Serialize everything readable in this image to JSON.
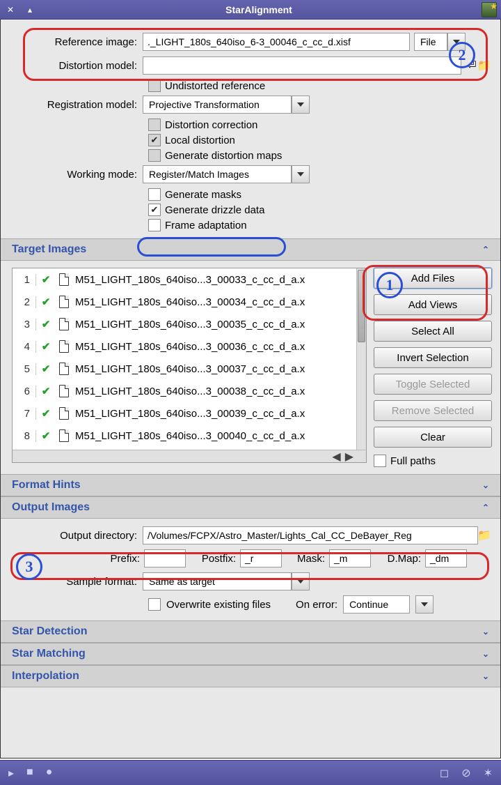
{
  "title": "StarAlignment",
  "form": {
    "reference_label": "Reference image:",
    "reference_value": "._LIGHT_180s_640iso_6-3_00046_c_cc_d.xisf",
    "reference_source": "File",
    "distortion_label": "Distortion model:",
    "distortion_value": "",
    "undistorted": "Undistorted reference",
    "reg_model_label": "Registration model:",
    "reg_model_value": "Projective Transformation",
    "distortion_corr": "Distortion correction",
    "local_distortion": "Local distortion",
    "gen_maps": "Generate distortion maps",
    "working_mode_label": "Working mode:",
    "working_mode_value": "Register/Match Images",
    "gen_masks": "Generate masks",
    "gen_drizzle": "Generate drizzle data",
    "frame_adapt": "Frame adaptation"
  },
  "sections": {
    "target": "Target Images",
    "format_hints": "Format Hints",
    "output_images": "Output Images",
    "star_detection": "Star Detection",
    "star_matching": "Star Matching",
    "interpolation": "Interpolation"
  },
  "files": [
    "M51_LIGHT_180s_640iso...3_00033_c_cc_d_a.x",
    "M51_LIGHT_180s_640iso...3_00034_c_cc_d_a.x",
    "M51_LIGHT_180s_640iso...3_00035_c_cc_d_a.x",
    "M51_LIGHT_180s_640iso...3_00036_c_cc_d_a.x",
    "M51_LIGHT_180s_640iso...3_00037_c_cc_d_a.x",
    "M51_LIGHT_180s_640iso...3_00038_c_cc_d_a.x",
    "M51_LIGHT_180s_640iso...3_00039_c_cc_d_a.x",
    "M51_LIGHT_180s_640iso...3_00040_c_cc_d_a.x"
  ],
  "buttons": {
    "add_files": "Add Files",
    "add_views": "Add Views",
    "select_all": "Select All",
    "invert": "Invert Selection",
    "toggle": "Toggle Selected",
    "remove": "Remove Selected",
    "clear": "Clear",
    "full_paths": "Full paths"
  },
  "output": {
    "dir_label": "Output directory:",
    "dir_value": "/Volumes/FCPX/Astro_Master/Lights_Cal_CC_DeBayer_Reg",
    "prefix_label": "Prefix:",
    "prefix_value": "",
    "postfix_label": "Postfix:",
    "postfix_value": "_r",
    "mask_label": "Mask:",
    "mask_value": "_m",
    "dmap_label": "D.Map:",
    "dmap_value": "_dm",
    "sample_label": "Sample format:",
    "sample_value": "Same as target",
    "overwrite": "Overwrite existing files",
    "onerror_label": "On error:",
    "onerror_value": "Continue"
  },
  "annotations": {
    "1": "1",
    "2": "2",
    "3": "3"
  }
}
